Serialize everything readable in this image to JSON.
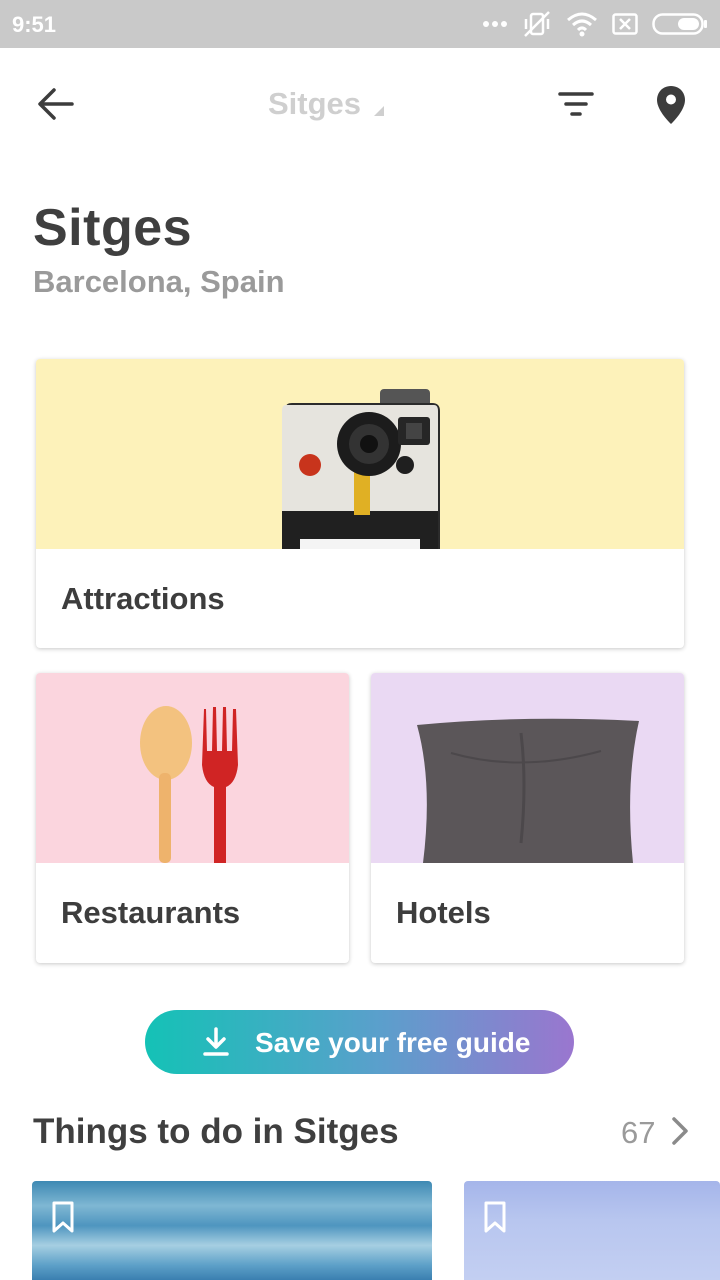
{
  "status_bar": {
    "time": "9:51",
    "icons": [
      "more-dots-icon",
      "vibrate-off-icon",
      "wifi-icon",
      "sim-x-icon",
      "battery-icon"
    ]
  },
  "app_bar": {
    "title": "Sitges",
    "icons": [
      "back-arrow-icon",
      "filter-icon",
      "location-pin-icon"
    ]
  },
  "header": {
    "city": "Sitges",
    "region": "Barcelona, Spain"
  },
  "categories": [
    {
      "label": "Attractions",
      "image": "instant-camera",
      "bg": "#fdf2ba"
    },
    {
      "label": "Restaurants",
      "image": "spoon-and-fork",
      "bg": "#fbd5de"
    },
    {
      "label": "Hotels",
      "image": "pillow",
      "bg": "#ead9f3"
    }
  ],
  "save_button": {
    "label": "Save your free guide",
    "icon": "download-icon",
    "gradient": [
      "#14c2b6",
      "#9a76cf"
    ]
  },
  "things_to_do": {
    "title": "Things to do in Sitges",
    "count": "67"
  },
  "colors": {
    "status_bar": "#c9c9c9",
    "text_dark": "#3f3f3f",
    "text_muted": "#9a9a9a"
  }
}
